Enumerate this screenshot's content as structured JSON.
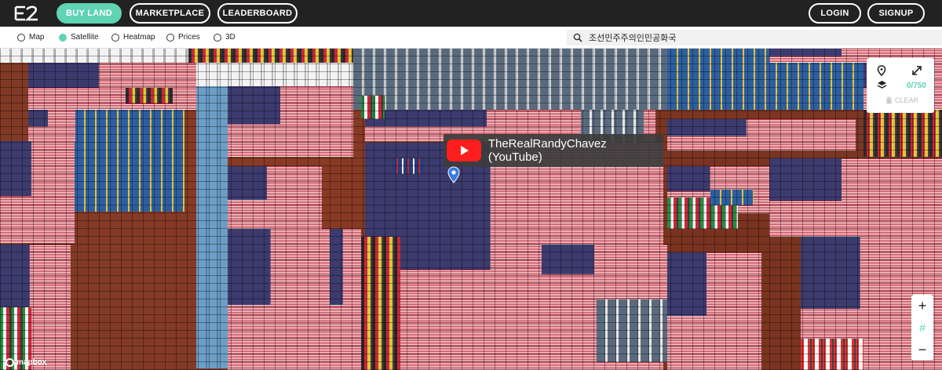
{
  "header": {
    "logo_icon": "e2-logo-icon",
    "nav": [
      {
        "label": "BUY LAND",
        "active": true
      },
      {
        "label": "MARKETPLACE",
        "active": false
      },
      {
        "label": "LEADERBOARD",
        "active": false
      }
    ],
    "login_label": "LOGIN",
    "signup_label": "SIGNUP"
  },
  "layers": [
    {
      "label": "Map",
      "selected": false
    },
    {
      "label": "Satellite",
      "selected": true
    },
    {
      "label": "Heatmap",
      "selected": false
    },
    {
      "label": "Prices",
      "selected": false
    },
    {
      "label": "3D",
      "selected": false
    }
  ],
  "search": {
    "value": "조선민주주의인민공화국",
    "icon": "search-icon"
  },
  "tooltip": {
    "icon": "youtube-icon",
    "text": "TheRealRandyChavez (YouTube)"
  },
  "panel": {
    "location_icon": "location-pin-icon",
    "expand_icon": "expand-icon",
    "layers_icon": "layers-icon",
    "selection_count": "0/750",
    "clear_label": "CLEAR",
    "clear_icon": "trash-icon"
  },
  "zoom": {
    "in_label": "+",
    "grid_label": "#",
    "out_label": "−"
  },
  "attribution": "mapbox",
  "colors": {
    "accent": "#5fd3b3",
    "topbar": "#222222",
    "youtube": "#ff1e1e",
    "terrain": "#7d3a27"
  }
}
